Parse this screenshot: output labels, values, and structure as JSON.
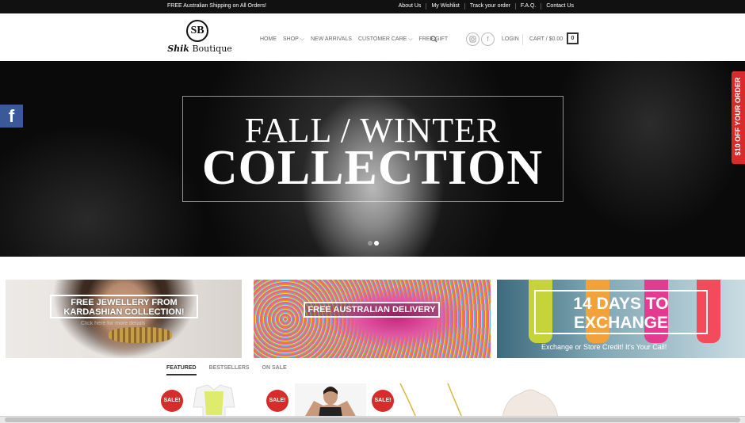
{
  "topbar": {
    "promo": "FREE Australian Shipping on All Orders!",
    "links": [
      "About Us",
      "My Wishlist",
      "Track your order",
      "F.A.Q.",
      "Contact Us"
    ]
  },
  "header": {
    "logo": {
      "monogram": "SB",
      "script": "Shik",
      "word": "Boutique"
    },
    "nav": [
      "HOME",
      "SHOP ⌵",
      "NEW ARRIVALS",
      "CUSTOMER CARE ⌵",
      "FREE GIFT"
    ],
    "social_icons": [
      "instagram-icon",
      "facebook-icon"
    ],
    "facebook_glyph": "f",
    "login": "LOGIN",
    "cart_label": "CART / $0.00",
    "cart_count": "0"
  },
  "hero": {
    "line1": "FALL / WINTER",
    "line2": "COLLECTION",
    "slides": 2,
    "active_slide": 2
  },
  "side": {
    "facebook_glyph": "f",
    "discount_tab": "$10 OFF YOUR ORDER"
  },
  "banners": [
    {
      "title_line1": "FREE JEWELLERY FROM",
      "title_line2": "KARDASHIAN COLLECTION!",
      "subtitle": "Click here for more details"
    },
    {
      "title": "FREE AUSTRALIAN DELIVERY"
    },
    {
      "title_line1": "14 DAYS TO",
      "title_line2": "EXCHANGE",
      "subtitle": "Exchange or Store Credit! It's Your Call!"
    }
  ],
  "product_tabs": [
    {
      "label": "FEATURED",
      "active": true
    },
    {
      "label": "BESTSELLERS",
      "active": false
    },
    {
      "label": "ON SALE",
      "active": false
    }
  ],
  "sale_badge": "SALE!",
  "colors": {
    "topbar": "#111111",
    "sale": "#d62c2c",
    "facebook": "#3b5998",
    "shoes": [
      "#c6d43a",
      "#f2a23a",
      "#e23b8f",
      "#f44b5c"
    ]
  }
}
